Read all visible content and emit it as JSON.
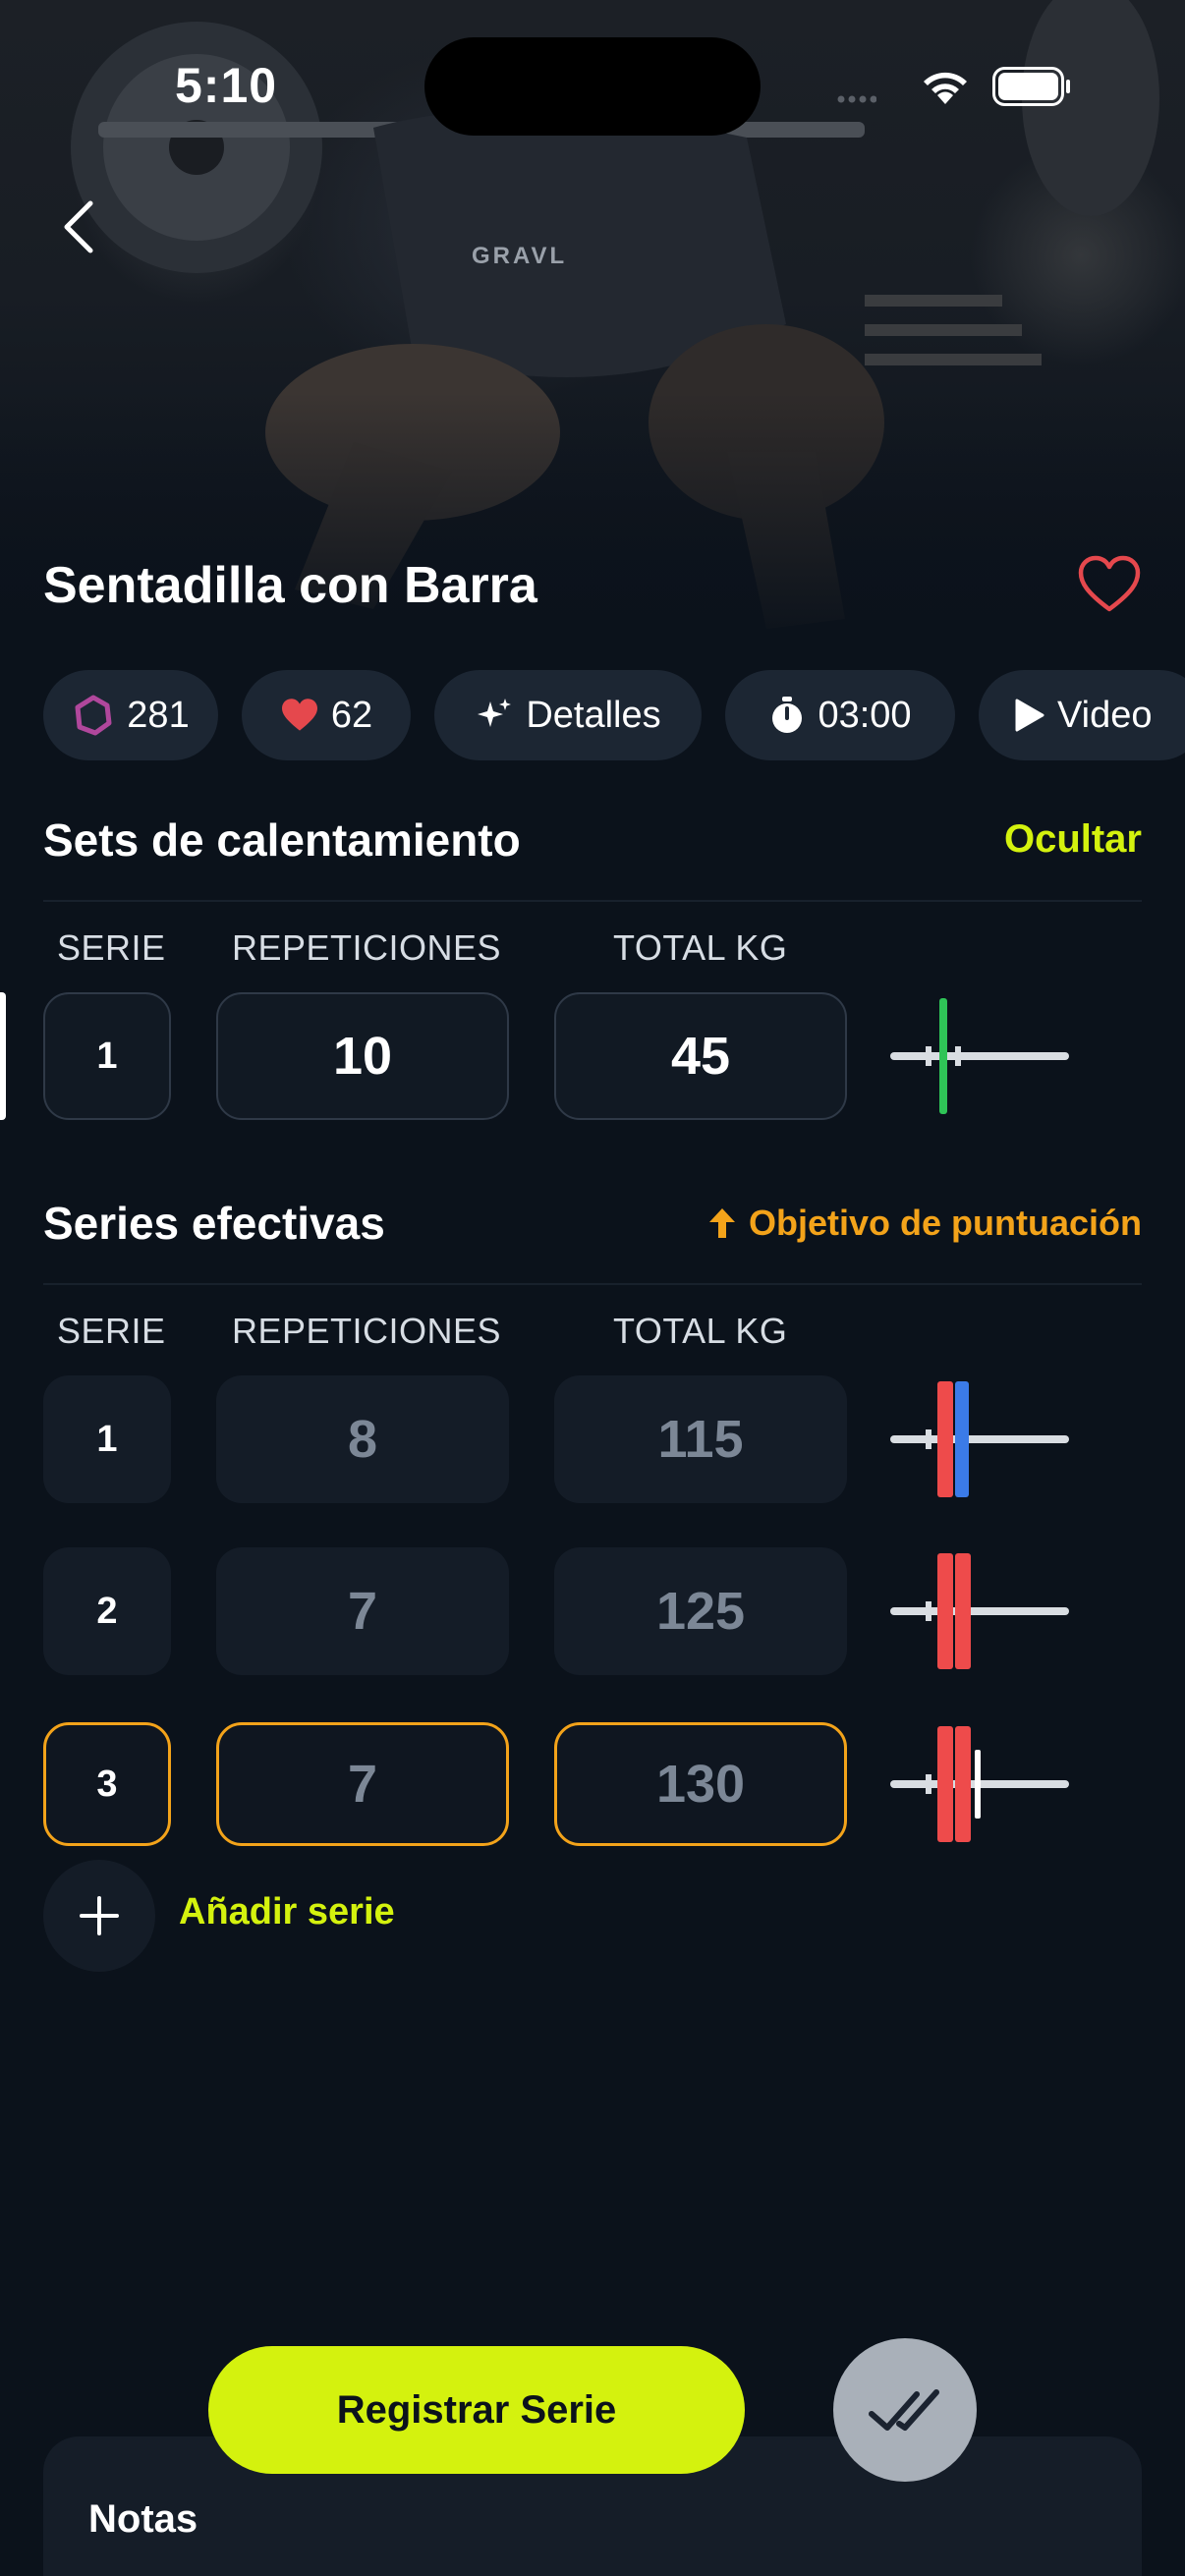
{
  "status_bar": {
    "time": "5:10"
  },
  "hero": {
    "shirt_text": "GRAVL"
  },
  "exercise": {
    "title": "Sentadilla con Barra",
    "chips": [
      {
        "icon": "ring-icon",
        "label": "281"
      },
      {
        "icon": "heart-icon",
        "label": "62"
      },
      {
        "icon": "sparkle-icon",
        "label": "Detalles"
      },
      {
        "icon": "stopwatch-icon",
        "label": "03:00"
      },
      {
        "icon": "play-icon",
        "label": "Video"
      }
    ]
  },
  "warmup": {
    "title": "Sets de calentamiento",
    "action": "Ocultar",
    "headers": {
      "set": "SERIE",
      "reps": "REPETICIONES",
      "weight": "TOTAL KG"
    },
    "rows": [
      {
        "set": "1",
        "reps": "10",
        "weight": "45",
        "plates": [
          "green"
        ]
      }
    ]
  },
  "effective": {
    "title": "Series efectivas",
    "action": "Objetivo de puntuación",
    "headers": {
      "set": "SERIE",
      "reps": "REPETICIONES",
      "weight": "TOTAL KG"
    },
    "rows": [
      {
        "set": "1",
        "reps": "8",
        "weight": "115",
        "plates": [
          "red",
          "blue"
        ]
      },
      {
        "set": "2",
        "reps": "7",
        "weight": "125",
        "plates": [
          "red",
          "red"
        ]
      },
      {
        "set": "3",
        "reps": "7",
        "weight": "130",
        "plates": [
          "red",
          "red",
          "white"
        ],
        "active": true
      }
    ]
  },
  "add_set": {
    "label": "Añadir serie"
  },
  "register": {
    "label": "Registrar Serie"
  },
  "notes": {
    "title": "Notas"
  },
  "colors": {
    "accent": "#d4f20e",
    "target": "#f3a31a",
    "favorite": "#e5484d",
    "plate_red": "#ee4b4b",
    "plate_blue": "#3b7be8",
    "plate_green": "#2fc457"
  }
}
